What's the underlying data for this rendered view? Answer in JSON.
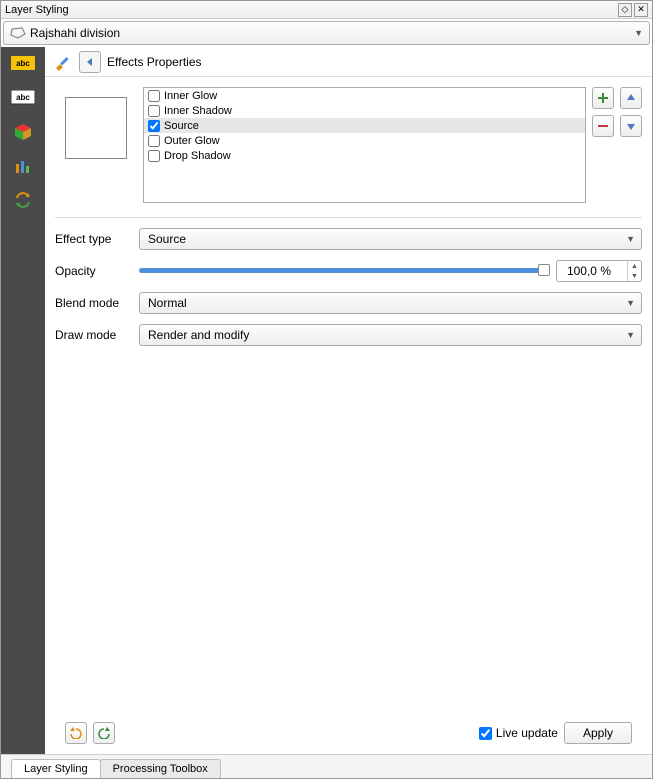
{
  "title": "Layer Styling",
  "layer": {
    "name": "Rajshahi division"
  },
  "header": {
    "label": "Effects Properties"
  },
  "effects": {
    "items": [
      {
        "label": "Inner Glow",
        "checked": false
      },
      {
        "label": "Inner Shadow",
        "checked": false
      },
      {
        "label": "Source",
        "checked": true
      },
      {
        "label": "Outer Glow",
        "checked": false
      },
      {
        "label": "Drop Shadow",
        "checked": false
      }
    ]
  },
  "effect_type": {
    "label": "Effect type",
    "value": "Source"
  },
  "opacity": {
    "label": "Opacity",
    "value": "100,0 %"
  },
  "blend_mode": {
    "label": "Blend mode",
    "value": "Normal"
  },
  "draw_mode": {
    "label": "Draw mode",
    "value": "Render and modify"
  },
  "live_update": {
    "label": "Live update",
    "checked": true
  },
  "apply": {
    "label": "Apply"
  },
  "tabs": {
    "a": "Layer Styling",
    "b": "Processing Toolbox"
  }
}
